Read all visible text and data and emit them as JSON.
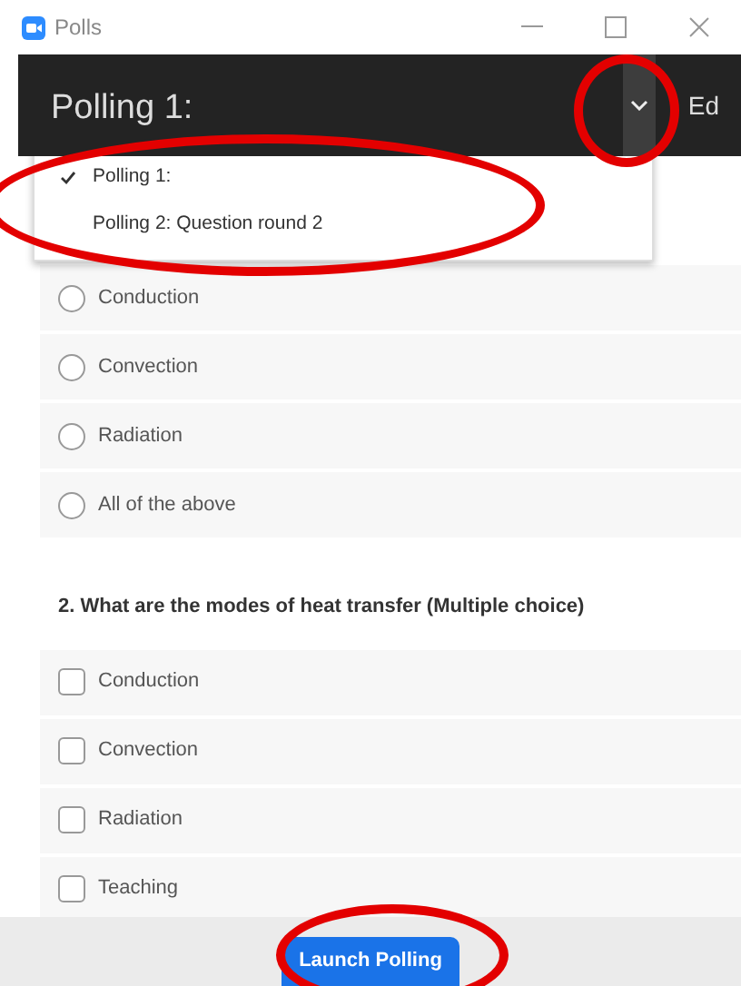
{
  "window": {
    "title": "Polls"
  },
  "header": {
    "title": "Polling 1:",
    "edit_label": "Ed"
  },
  "poll_menu": {
    "items": [
      {
        "label": "Polling 1:",
        "selected": true
      },
      {
        "label": "Polling 2: Question round 2",
        "selected": false
      }
    ]
  },
  "questions": [
    {
      "kind": "single",
      "options": [
        {
          "label": "Conduction",
          "checked": false
        },
        {
          "label": "Convection",
          "checked": false
        },
        {
          "label": "Radiation",
          "checked": false
        },
        {
          "label": "All of the above",
          "checked": false
        }
      ]
    },
    {
      "kind": "multiple",
      "title": "2. What are the modes of heat transfer (Multiple choice)",
      "options": [
        {
          "label": "Conduction",
          "checked": false
        },
        {
          "label": "Convection",
          "checked": false
        },
        {
          "label": "Radiation",
          "checked": false
        },
        {
          "label": "Teaching",
          "checked": false
        }
      ]
    }
  ],
  "footer": {
    "button": "Launch Polling"
  }
}
